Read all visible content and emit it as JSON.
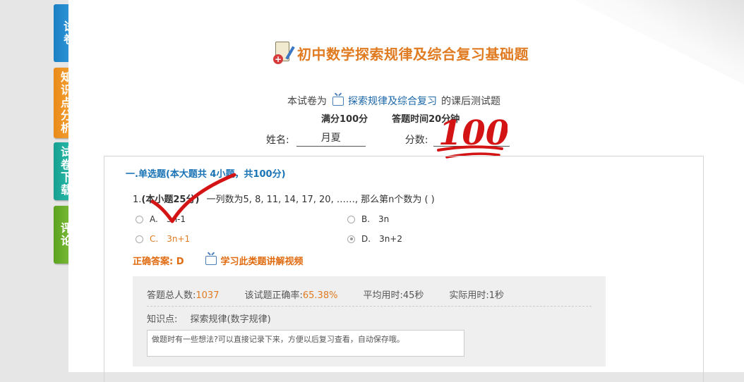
{
  "sidebar": {
    "tabs": [
      {
        "label": "试卷",
        "color": "#1b7fc4"
      },
      {
        "label": "知识点分析",
        "color": "#e98a18"
      },
      {
        "label": "试卷下载",
        "color": "#16a090"
      },
      {
        "label": "评论",
        "color": "#5aa21e"
      }
    ]
  },
  "header": {
    "title": "初中数学探索规律及综合复习基础题",
    "subtitle_prefix": "本试卷为",
    "subtitle_link": "探索规律及综合复习",
    "subtitle_suffix": "的课后测试题",
    "full_score": "满分100分",
    "time_limit": "答题时间20分钟",
    "name_label": "姓名:",
    "name_value": "月夏",
    "score_label": "分数:",
    "score_stamp": "100"
  },
  "section": {
    "title": "一.单选题(本大题共 4小题，共100分)",
    "question": {
      "number": "1.",
      "points": "(本小题25分)",
      "text": "一列数为5, 8, 11, 14, 17, 20, ……, 那么第n个数为 ( )",
      "options": [
        {
          "label": "A.",
          "text": "3n-1",
          "selected": false
        },
        {
          "label": "B.",
          "text": "3n",
          "selected": false
        },
        {
          "label": "C.",
          "text": "3n+1",
          "selected": false
        },
        {
          "label": "D.",
          "text": "3n+2",
          "selected": true
        }
      ],
      "correct_answer": "正确答案: D",
      "video_link": "学习此类题讲解视频"
    },
    "stats": {
      "total_label": "答题总人数:",
      "total_value": "1037",
      "rate_label": "该试题正确率:",
      "rate_value": "65.38%",
      "avg_label": "平均用时:",
      "avg_value": "45秒",
      "actual_label": "实际用时:",
      "actual_value": "1秒",
      "kp_label": "知识点:",
      "kp_value": "探索规律(数字规律)",
      "note_placeholder": "做题时有一些想法?可以直接记录下来，方便以后复习查看，自动保存哦。"
    }
  },
  "colors": {
    "title": "#e07b22",
    "section_title": "#1a73b5",
    "answer": "#e06b10",
    "stamp": "#d41414"
  }
}
